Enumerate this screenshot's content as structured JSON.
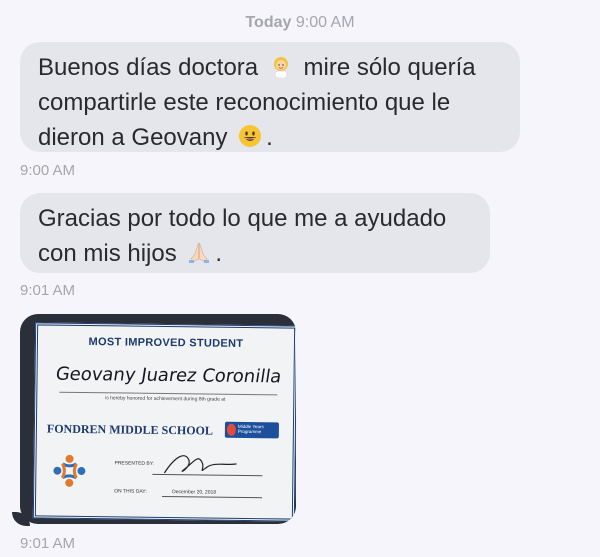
{
  "header": {
    "day": "Today",
    "time": "9:00 AM"
  },
  "messages": [
    {
      "line1_a": "Buenos días doctora",
      "line1_b": "mire sólo quería",
      "line2": "compartirle este reconocimiento que le",
      "line3_a": "dieron a Geovany",
      "line3_b": ".",
      "emoji1": "woman-health-worker-emoji-icon",
      "emoji2": "smiling-face-emoji-icon",
      "timestamp": "9:00 AM"
    },
    {
      "line1": "Gracias por todo lo que me a ayudado",
      "line2_a": "con mis hijos",
      "line2_b": ".",
      "emoji": "folded-hands-emoji-icon",
      "timestamp": "9:01 AM"
    },
    {
      "certificate": {
        "title": "MOST IMPROVED STUDENT",
        "name": "Geovany Juarez Coronilla",
        "subtitle": "is hereby honored for achievement during 8th grade at",
        "school": "FONDREN MIDDLE SCHOOL",
        "logo_text": "Middle Years Programme",
        "presented_by": "PRESENTED BY:",
        "on_this_day": "ON THIS DAY:",
        "date": "December 20, 2018"
      },
      "timestamp": "9:01 AM"
    }
  ],
  "colors": {
    "background": "#f5f5fb",
    "bubble": "#e5e6ec",
    "text": "#2a2a2c",
    "timestamp": "#a5a7ad",
    "certificate_blue": "#1d3b70"
  }
}
